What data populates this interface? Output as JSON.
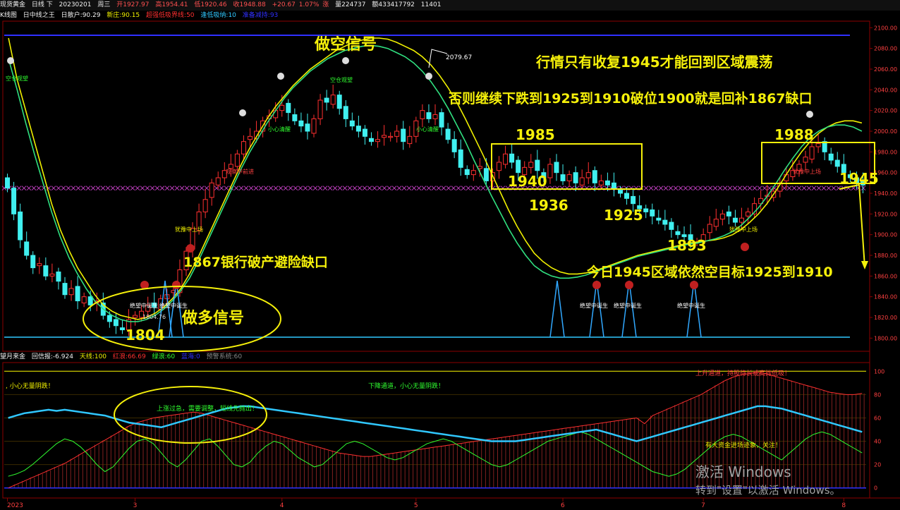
{
  "header": {
    "instrument": "现货黄金",
    "period": "日线 下",
    "date": "20230201",
    "weekday": "周三",
    "open": "开1927.97",
    "high": "高1954.41",
    "low": "低1920.46",
    "close": "收1948.88",
    "change_label": "涨",
    "change": "+20.67",
    "change_pct": "1.07%",
    "volume": "量224737",
    "amount": "额433417792",
    "extra": "11401"
  },
  "indicator_header": {
    "name": "K线图",
    "sub": "日中线之王",
    "items": [
      {
        "text": "日散户:90.29",
        "color": "#f0f0f0"
      },
      {
        "text": "新庄:90.15",
        "color": "#f0f000"
      },
      {
        "text": "超强低吸界线:50",
        "color": "#ff3030"
      },
      {
        "text": "逢低吸纳:10",
        "color": "#30c8ff"
      },
      {
        "text": "准备减持:93",
        "color": "#3030ff"
      }
    ]
  },
  "sub_header": {
    "name": "望月来金",
    "items": [
      {
        "text": "回信报:-6.924",
        "color": "#f0f0f0"
      },
      {
        "text": "天线:100",
        "color": "#f0f000"
      },
      {
        "text": "红浪:66.69",
        "color": "#ff3030"
      },
      {
        "text": "绿浪:60",
        "color": "#30ff30"
      },
      {
        "text": "蓝海:0",
        "color": "#3030ff"
      },
      {
        "text": "预警系统:60",
        "color": "#888888"
      }
    ]
  },
  "annotations": {
    "short_signal": "做空信号",
    "long_signal": "做多信号",
    "note1": "行情只有收复1945才能回到区域震荡",
    "note2": "否则继续下跌到1925到1910破位1900就是回补1867缺口",
    "note3": "1867银行破产避险缺口",
    "note4": "今日1945区域依然空目标1925到1910",
    "levels": [
      "1985",
      "1940",
      "1936",
      "1925",
      "1893",
      "1988",
      "1945",
      "1804"
    ],
    "peak_value": "2079.67",
    "low_value": "1804.76",
    "small_labels": [
      "犹豫中上场",
      "空仓观望",
      "小心清醒",
      "空仓观望",
      "小心清醒",
      "观察中前进",
      "犹豫中上场",
      "绝望中诞生",
      "绝望中诞生",
      "绝望中诞生",
      "绝望中诞生",
      "犹豫中上场",
      "绝望中诞生"
    ],
    "sub_texts": [
      ", 小心无量阴跌！",
      "下降通道，小心无量阴跌！",
      "上涨过急，需要调整，短线先抛出！",
      "上升通道，持股待长或高抛低吸！",
      "有大资金进场迹象，关注！"
    ]
  },
  "watermark": {
    "line1": "激活 Windows",
    "line2": "转到\"设置\"以激活 Windows。"
  },
  "chart_data": [
    {
      "type": "candlestick",
      "ylim": [
        1790,
        2105
      ],
      "y_ticks": [
        2100,
        2080,
        2060,
        2040,
        2020,
        2000,
        1980,
        1960,
        1940,
        1920,
        1900,
        1880,
        1860,
        1840,
        1820,
        1800,
        1780
      ],
      "x_tick_labels": [
        {
          "label": "2023",
          "index": 0
        },
        {
          "label": "3",
          "index": 20
        },
        {
          "label": "4",
          "index": 43
        },
        {
          "label": "5",
          "index": 64
        },
        {
          "label": "6",
          "index": 87
        },
        {
          "label": "7",
          "index": 109
        },
        {
          "label": "8",
          "index": 131
        }
      ],
      "closes": [
        1945,
        1920,
        1895,
        1880,
        1868,
        1872,
        1860,
        1862,
        1855,
        1842,
        1848,
        1836,
        1840,
        1832,
        1836,
        1822,
        1816,
        1812,
        1808,
        1818,
        1822,
        1826,
        1832,
        1830,
        1838,
        1842,
        1846,
        1866,
        1884,
        1906,
        1922,
        1934,
        1950,
        1955,
        1962,
        1968,
        1978,
        1990,
        1995,
        2000,
        2010,
        2015,
        2020,
        2025,
        2018,
        2010,
        2005,
        2000,
        2012,
        2030,
        2028,
        2035,
        2022,
        2012,
        2005,
        2000,
        1995,
        1990,
        1992,
        1996,
        1995,
        2000,
        1990,
        1995,
        2010,
        2020,
        2012,
        2016,
        2004,
        1992,
        1980,
        1965,
        1958,
        1962,
        1966,
        1952,
        1960,
        1970,
        1978,
        1970,
        1960,
        1965,
        1970,
        1962,
        1955,
        1968,
        1960,
        1952,
        1958,
        1950,
        1955,
        1960,
        1950,
        1952,
        1948,
        1945,
        1940,
        1935,
        1930,
        1925,
        1922,
        1918,
        1914,
        1910,
        1905,
        1900,
        1898,
        1895,
        1893,
        1900,
        1910,
        1915,
        1920,
        1918,
        1912,
        1916,
        1922,
        1930,
        1935,
        1938,
        1942,
        1950,
        1958,
        1962,
        1968,
        1975,
        1985,
        1988,
        1980,
        1972,
        1966,
        1960,
        1955,
        1950,
        1948
      ],
      "ma_yellow": [
        2090,
        2050,
        2020,
        1990,
        1960,
        1930,
        1905,
        1885,
        1868,
        1855,
        1842,
        1832,
        1826,
        1822,
        1820,
        1818,
        1820,
        1824,
        1830,
        1838,
        1848,
        1862,
        1878,
        1896,
        1914,
        1932,
        1950,
        1968,
        1984,
        1998,
        2012,
        2024,
        2034,
        2044,
        2052,
        2060,
        2066,
        2072,
        2078,
        2082,
        2086,
        2088,
        2090,
        2090,
        2089,
        2086,
        2082,
        2078,
        2072,
        2064,
        2054,
        2042,
        2028,
        2012,
        1995,
        1978,
        1960,
        1942,
        1924,
        1908,
        1894,
        1882,
        1874,
        1868,
        1864,
        1862,
        1862,
        1863,
        1865,
        1868,
        1871,
        1874,
        1877,
        1880,
        1882,
        1884,
        1886,
        1888,
        1890,
        1892,
        1893,
        1894,
        1895,
        1897,
        1900,
        1905,
        1912,
        1920,
        1930,
        1942,
        1955,
        1968,
        1980,
        1990,
        1998,
        2004,
        2008,
        2010,
        2010,
        2008
      ],
      "ma_green": [
        2070,
        2040,
        2008,
        1978,
        1950,
        1922,
        1898,
        1878,
        1862,
        1848,
        1836,
        1828,
        1822,
        1818,
        1816,
        1816,
        1818,
        1822,
        1828,
        1836,
        1846,
        1858,
        1874,
        1892,
        1910,
        1928,
        1946,
        1964,
        1980,
        1994,
        2008,
        2020,
        2032,
        2042,
        2050,
        2058,
        2064,
        2070,
        2074,
        2078,
        2080,
        2082,
        2083,
        2082,
        2080,
        2076,
        2072,
        2066,
        2058,
        2048,
        2036,
        2022,
        2006,
        1990,
        1972,
        1955,
        1938,
        1922,
        1906,
        1892,
        1880,
        1870,
        1864,
        1860,
        1858,
        1858,
        1859,
        1861,
        1864,
        1867,
        1870,
        1873,
        1876,
        1879,
        1881,
        1883,
        1885,
        1887,
        1889,
        1891,
        1892,
        1894,
        1896,
        1899,
        1903,
        1909,
        1917,
        1926,
        1937,
        1949,
        1962,
        1974,
        1985,
        1994,
        2000,
        2004,
        2006,
        2006,
        2004,
        2000
      ]
    },
    {
      "type": "line",
      "ylim": [
        -5,
        105
      ],
      "y_ticks": [
        100,
        80,
        60,
        40,
        20,
        0
      ],
      "series": [
        {
          "name": "天线",
          "color": "#f0f000",
          "values": [
            100
          ]
        },
        {
          "name": "蓝海",
          "color": "#30c8ff",
          "values": [
            0,
            3,
            6,
            9,
            12,
            15,
            18,
            21,
            25,
            29,
            33,
            37,
            41,
            45,
            49,
            53,
            56,
            58,
            60,
            61,
            62,
            63,
            64,
            65,
            64,
            62,
            60,
            58,
            56,
            54,
            52,
            50,
            48,
            46,
            44,
            42,
            40,
            38,
            36,
            34,
            32,
            30,
            29,
            28,
            27,
            27,
            28,
            29,
            30,
            31,
            32,
            33,
            34,
            35,
            36,
            37,
            38,
            39,
            40,
            41,
            42,
            43,
            44,
            45,
            46,
            47,
            48,
            49,
            50,
            51,
            52,
            53,
            54,
            55,
            56,
            57,
            58,
            59,
            60,
            55,
            62,
            65,
            68,
            71,
            74,
            77,
            80,
            84,
            88,
            92,
            95,
            97,
            98,
            99,
            98,
            96,
            94,
            92,
            90,
            88,
            86,
            84,
            82,
            81,
            80,
            80,
            81
          ]
        },
        {
          "name": "红浪",
          "color": "#ff3030",
          "values": [
            60,
            62,
            64,
            65,
            66,
            67,
            66,
            67,
            66,
            65,
            64,
            63,
            62,
            60,
            58,
            56,
            55,
            54,
            53,
            52,
            54,
            56,
            58,
            60,
            62,
            64,
            66,
            68,
            69,
            70,
            70,
            69,
            68,
            67,
            66,
            65,
            64,
            63,
            62,
            61,
            60,
            59,
            58,
            57,
            56,
            55,
            54,
            53,
            52,
            51,
            50,
            49,
            48,
            47,
            46,
            45,
            44,
            43,
            42,
            41,
            40,
            40,
            40,
            40,
            41,
            42,
            43,
            44,
            45,
            46,
            47,
            48,
            49,
            50,
            48,
            46,
            44,
            42,
            40,
            42,
            44,
            46,
            48,
            50,
            52,
            54,
            56,
            58,
            60,
            62,
            64,
            66,
            68,
            70,
            70,
            69,
            68,
            66,
            64,
            62,
            60,
            58,
            56,
            54,
            52,
            50,
            48
          ]
        },
        {
          "name": "绿浪",
          "color": "#30ff30",
          "values": [
            10,
            12,
            15,
            20,
            26,
            32,
            38,
            42,
            40,
            35,
            28,
            20,
            14,
            18,
            26,
            34,
            40,
            42,
            38,
            30,
            22,
            18,
            24,
            32,
            40,
            42,
            36,
            28,
            20,
            18,
            22,
            30,
            36,
            40,
            38,
            32,
            26,
            22,
            18,
            20,
            26,
            32,
            38,
            40,
            38,
            34,
            30,
            26,
            24,
            26,
            30,
            34,
            38,
            40,
            42,
            40,
            36,
            32,
            28,
            24,
            20,
            18,
            20,
            24,
            28,
            32,
            36,
            40,
            42,
            44,
            46,
            48,
            46,
            42,
            38,
            34,
            30,
            26,
            22,
            18,
            14,
            12,
            10,
            12,
            16,
            22,
            28,
            34,
            40,
            44,
            46,
            44,
            40,
            36,
            32,
            28,
            24,
            30,
            36,
            42,
            46,
            48,
            46,
            42,
            38,
            34,
            30
          ]
        }
      ]
    }
  ]
}
